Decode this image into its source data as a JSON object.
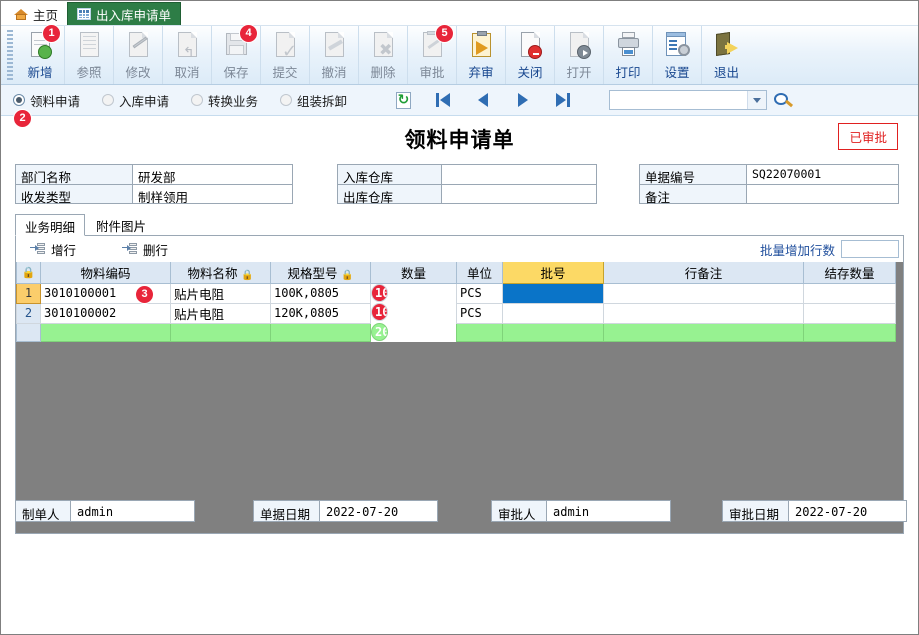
{
  "window": {
    "tabs": [
      {
        "label": "主页",
        "icon": "home-icon",
        "active": false
      },
      {
        "label": "出入库申请单",
        "icon": "grid-icon",
        "active": true
      }
    ]
  },
  "ribbon": {
    "buttons": [
      {
        "label": "新增",
        "icon": "new-page-plus-icon",
        "enabled": true,
        "badge": "1"
      },
      {
        "label": "参照",
        "icon": "reference-lines-icon",
        "enabled": false,
        "badge": ""
      },
      {
        "label": "修改",
        "icon": "edit-pencil-icon",
        "enabled": false,
        "badge": ""
      },
      {
        "label": "取消",
        "icon": "undo-arrow-icon",
        "enabled": false,
        "badge": ""
      },
      {
        "label": "保存",
        "icon": "floppy-save-icon",
        "enabled": false,
        "badge": "4"
      },
      {
        "label": "提交",
        "icon": "submit-check-icon",
        "enabled": false,
        "badge": ""
      },
      {
        "label": "撤消",
        "icon": "revoke-icon",
        "enabled": false,
        "badge": ""
      },
      {
        "label": "删除",
        "icon": "delete-x-icon",
        "enabled": false,
        "badge": ""
      },
      {
        "label": "审批",
        "icon": "approve-clipboard-icon",
        "enabled": false,
        "badge": "5"
      },
      {
        "label": "弃审",
        "icon": "unapprove-clipboard-icon",
        "enabled": true,
        "badge": ""
      },
      {
        "label": "关闭",
        "icon": "close-forbid-icon",
        "enabled": true,
        "badge": ""
      },
      {
        "label": "打开",
        "icon": "open-page-icon",
        "enabled": false,
        "badge": ""
      },
      {
        "label": "打印",
        "icon": "printer-icon",
        "enabled": true,
        "badge": ""
      },
      {
        "label": "设置",
        "icon": "settings-gear-icon",
        "enabled": true,
        "badge": ""
      },
      {
        "label": "退出",
        "icon": "exit-door-icon",
        "enabled": true,
        "badge": ""
      }
    ]
  },
  "navbar": {
    "radios": [
      {
        "label": "领料申请",
        "selected": true
      },
      {
        "label": "入库申请",
        "selected": false
      },
      {
        "label": "转换业务",
        "selected": false
      },
      {
        "label": "组装拆卸",
        "selected": false
      }
    ],
    "badge": "2",
    "buttons": [
      {
        "name": "refresh-button",
        "icon": "refresh-icon"
      },
      {
        "name": "first-record-button",
        "icon": "first-record-icon"
      },
      {
        "name": "prev-record-button",
        "icon": "prev-record-icon"
      },
      {
        "name": "next-record-button",
        "icon": "next-record-icon"
      },
      {
        "name": "last-record-button",
        "icon": "last-record-icon"
      }
    ],
    "combo_value": "",
    "search_icon": "search-filter-icon"
  },
  "document": {
    "title": "领料申请单",
    "status": "已审批",
    "header_left": [
      {
        "label": "部门名称",
        "value": "研发部"
      },
      {
        "label": "收发类型",
        "value": "制样领用"
      }
    ],
    "header_mid": [
      {
        "label": "入库仓库",
        "value": ""
      },
      {
        "label": "出库仓库",
        "value": ""
      }
    ],
    "header_right": [
      {
        "label": "单据编号",
        "value": "SQ22070001"
      },
      {
        "label": "备注",
        "value": ""
      }
    ]
  },
  "detail": {
    "tabs": [
      {
        "label": "业务明细",
        "active": true
      },
      {
        "label": "附件图片",
        "active": false
      }
    ],
    "toolbar": {
      "add_row": "增行",
      "add_row_icon": "insert-row-icon",
      "delete_row": "删行",
      "delete_row_icon": "remove-row-icon",
      "batch_label": "批量增加行数",
      "batch_value": ""
    },
    "badge": "3",
    "columns": [
      {
        "label": "",
        "icon": "lock-icon"
      },
      {
        "label": "物料编码",
        "icon": ""
      },
      {
        "label": "物料名称",
        "icon": "lock-icon"
      },
      {
        "label": "规格型号",
        "icon": "lock-icon"
      },
      {
        "label": "数量",
        "icon": ""
      },
      {
        "label": "单位",
        "icon": ""
      },
      {
        "label": "批号",
        "icon": ""
      },
      {
        "label": "行备注",
        "icon": ""
      },
      {
        "label": "结存数量",
        "icon": ""
      }
    ],
    "highlight_column": "批号",
    "rows": [
      {
        "no": "1",
        "code": "3010100001",
        "name": "贴片电阻",
        "spec": "100K,0805",
        "qty": "100",
        "unit": "PCS",
        "batch": "",
        "remark": "",
        "balance": "",
        "current": true
      },
      {
        "no": "2",
        "code": "3010100002",
        "name": "贴片电阻",
        "spec": "120K,0805",
        "qty": "100",
        "unit": "PCS",
        "batch": "",
        "remark": "",
        "balance": "",
        "current": false
      }
    ],
    "summary": {
      "no": "",
      "code": "",
      "name": "",
      "spec": "",
      "qty": "200",
      "unit": "",
      "batch": "",
      "remark": "",
      "balance": ""
    }
  },
  "footer": {
    "fields": [
      {
        "label": "制单人",
        "value": "admin"
      },
      {
        "label": "单据日期",
        "value": "2022-07-20"
      },
      {
        "label": "审批人",
        "value": "admin"
      },
      {
        "label": "审批日期",
        "value": "2022-07-20"
      }
    ]
  },
  "colors": {
    "tab_active": "#2d7d46",
    "status_red": "#e02020",
    "badge_red": "#e8253a",
    "highlight_header": "#fcd965",
    "selected_cell": "#0a74c8",
    "summary_row": "#97f291",
    "grid_backdrop": "#808080"
  }
}
